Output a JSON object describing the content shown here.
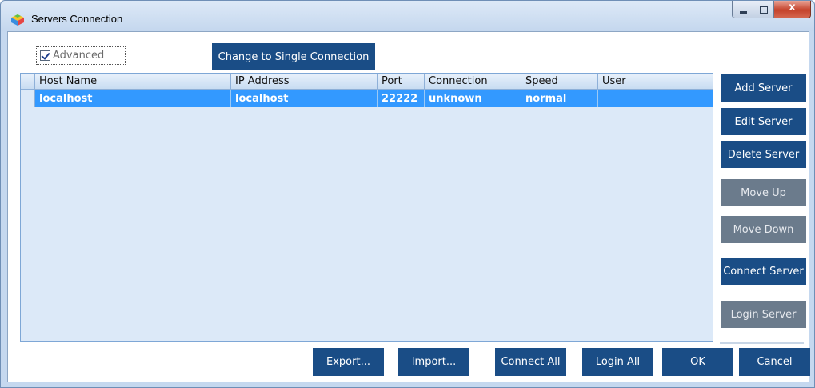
{
  "window": {
    "title": "Servers Connection",
    "close_glyph": "x"
  },
  "options": {
    "advanced_label": "Advanced",
    "advanced_checked": true,
    "change_mode_label": "Change to Single Connection"
  },
  "grid": {
    "columns": [
      "Host Name",
      "IP Address",
      "Port",
      "Connection",
      "Speed",
      "User"
    ],
    "rows": [
      {
        "host_name": "localhost",
        "ip_address": "localhost",
        "port": "22222",
        "connection": "unknown",
        "speed": "normal",
        "user": "",
        "selected": true
      }
    ]
  },
  "side_buttons": {
    "add_server": "Add Server",
    "edit_server": "Edit Server",
    "delete_server": "Delete Server",
    "move_up": "Move Up",
    "move_down": "Move Down",
    "connect_server": "Connect Server",
    "login_server": "Login Server"
  },
  "bottom_buttons": {
    "export": "Export...",
    "import": "Import...",
    "connect_all": "Connect All",
    "login_all": "Login All",
    "ok": "OK",
    "cancel": "Cancel"
  },
  "colors": {
    "button": "#1a4d86",
    "button_disabled": "#6b7b8c",
    "grid_background": "#dce9f8",
    "selection": "#3399ff",
    "frame": "#c5d8ef"
  },
  "icons": {
    "app": "servers-app-icon",
    "minimize": "minimize-icon",
    "maximize": "maximize-icon",
    "close": "close-icon"
  }
}
